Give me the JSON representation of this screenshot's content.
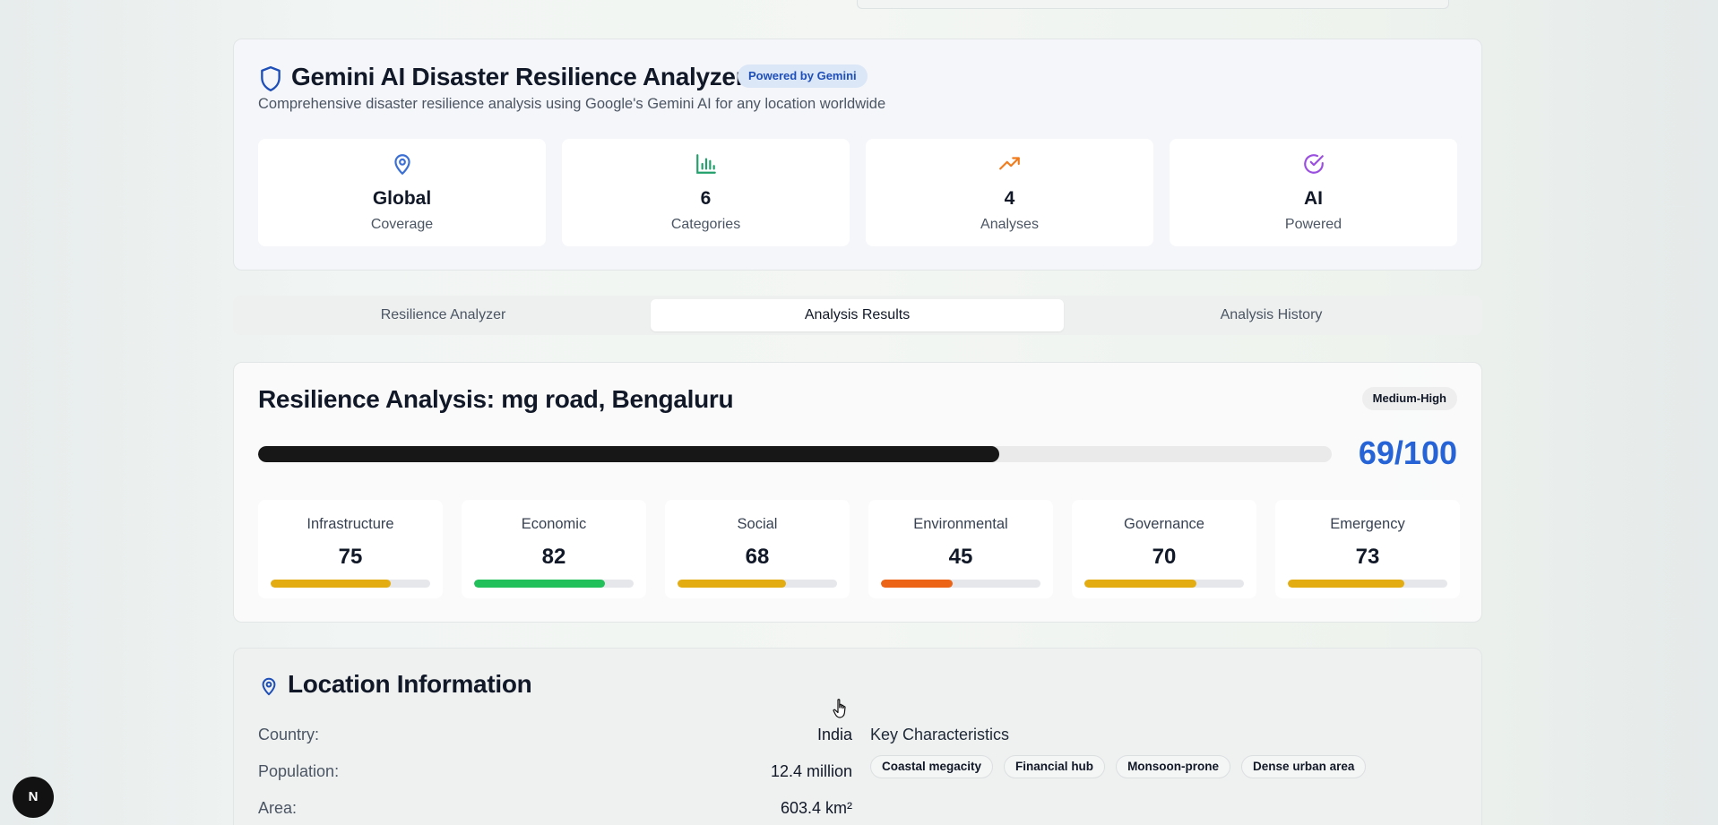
{
  "header": {
    "title": "Gemini AI Disaster Resilience Analyzer",
    "badge": "Powered by Gemini",
    "subtitle": "Comprehensive disaster resilience analysis using Google's Gemini AI for any location worldwide",
    "stats": [
      {
        "icon": "map-pin-icon",
        "value": "Global",
        "label": "Coverage",
        "color": "#3b6fd4"
      },
      {
        "icon": "bar-chart-icon",
        "value": "6",
        "label": "Categories",
        "color": "#22a06b"
      },
      {
        "icon": "trending-up-icon",
        "value": "4",
        "label": "Analyses",
        "color": "#f07c1e"
      },
      {
        "icon": "check-circle-icon",
        "value": "AI",
        "label": "Powered",
        "color": "#9b4fe0"
      }
    ]
  },
  "tabs": [
    {
      "label": "Resilience Analyzer",
      "active": false
    },
    {
      "label": "Analysis Results",
      "active": true
    },
    {
      "label": "Analysis History",
      "active": false
    }
  ],
  "results": {
    "title": "Resilience Analysis: mg road, Bengaluru",
    "level": "Medium-High",
    "overall_score": 69,
    "overall_score_text": "69/100",
    "categories": [
      {
        "name": "Infrastructure",
        "score": 75,
        "color": "#e3ac10"
      },
      {
        "name": "Economic",
        "score": 82,
        "color": "#22c05a"
      },
      {
        "name": "Social",
        "score": 68,
        "color": "#e3ac10"
      },
      {
        "name": "Environmental",
        "score": 45,
        "color": "#ec6415"
      },
      {
        "name": "Governance",
        "score": 70,
        "color": "#e3ac10"
      },
      {
        "name": "Emergency",
        "score": 73,
        "color": "#e3ac10"
      }
    ]
  },
  "location": {
    "title": "Location Information",
    "fields": [
      {
        "label": "Country:",
        "value": "India"
      },
      {
        "label": "Population:",
        "value": "12.4 million"
      },
      {
        "label": "Area:",
        "value": "603.4 km²"
      }
    ],
    "key_characteristics_title": "Key Characteristics",
    "tags": [
      "Coastal megacity",
      "Financial hub",
      "Monsoon-prone",
      "Dense urban area"
    ]
  },
  "dev_badge": "N"
}
